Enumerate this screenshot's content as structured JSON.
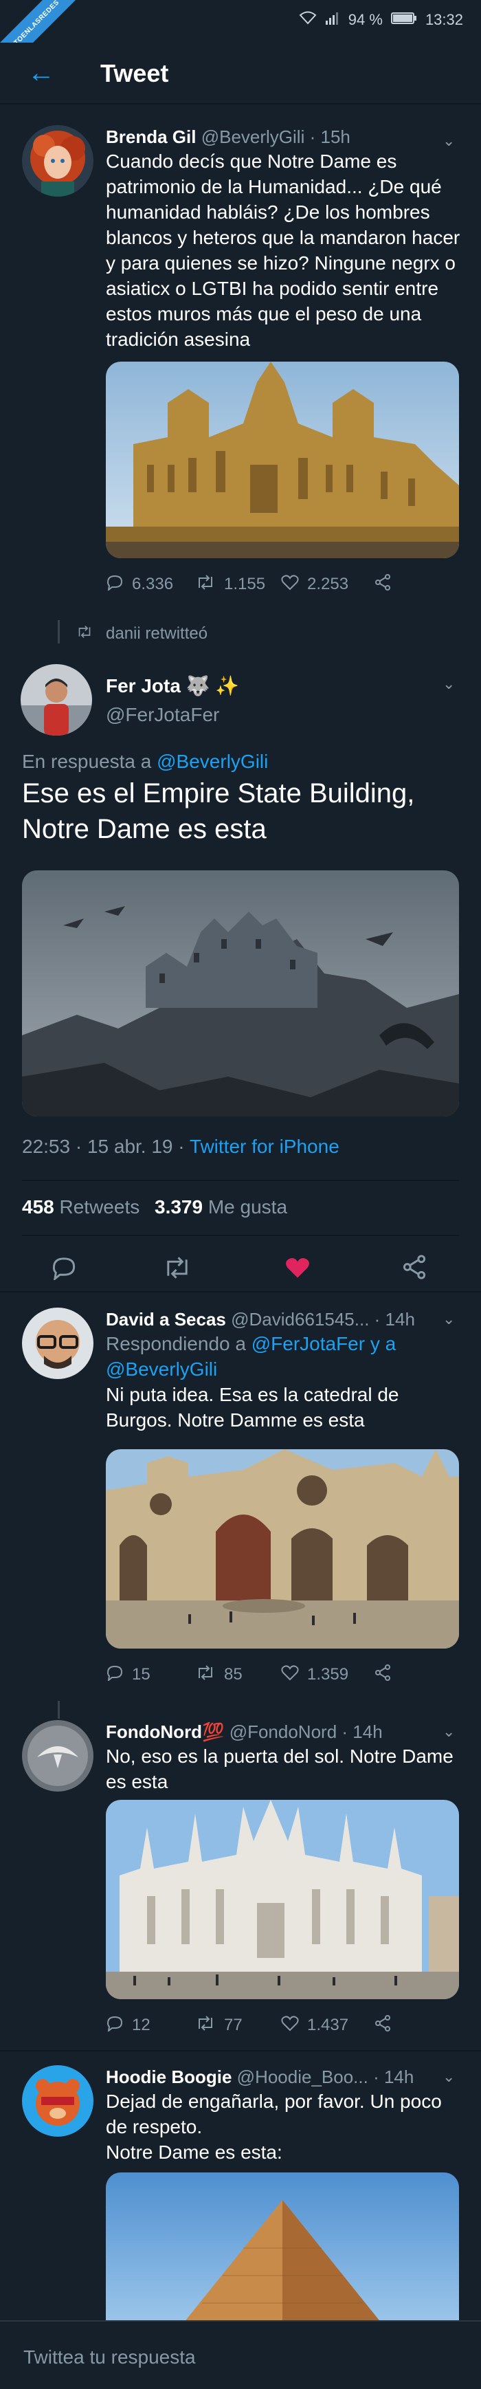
{
  "statusbar": {
    "battery": "94 %",
    "time": "13:32",
    "ribbon": "VISTOENLASREDES"
  },
  "header": {
    "title": "Tweet",
    "back": "←"
  },
  "tweets": [
    {
      "name": "Brenda Gil",
      "handle": "@BeverlyGili",
      "time": "· 15h",
      "text": "Cuando decís que Notre Dame es patrimonio de la Humanidad... ¿De qué humanidad habláis? ¿De los hombres blancos y heteros que la mandaron hacer y para quienes se hizo? Ningune negrx o asiaticx o LGTBI ha podido sentir entre estos muros más que el peso de una tradición asesina",
      "replies": "6.336",
      "retweets": "1.155",
      "likes": "2.253"
    },
    {
      "retweeted_by": "danii retwitteó",
      "name": "Fer Jota",
      "emoji": "🐺 ✨",
      "handle": "@FerJotaFer",
      "reply_prefix": "En respuesta a",
      "reply_to": "@BeverlyGili",
      "text": "Ese es el Empire State Building, Notre Dame es esta",
      "timestamp": "22:53 · 15 abr. 19 ·",
      "client": "Twitter for iPhone",
      "retweets_count": "458",
      "retweets_label": "Retweets",
      "likes_count": "3.379",
      "likes_label": "Me gusta"
    },
    {
      "name": "David a Secas",
      "handle": "@David661545...",
      "time": "· 14h",
      "reply_prefix": "Respondiendo a",
      "reply_to": "@FerJotaFer y a @BeverlyGili",
      "text": "Ni puta idea. Esa es la catedral de Burgos. Notre Damme es esta",
      "replies": "15",
      "retweets": "85",
      "likes": "1.359"
    },
    {
      "name": "FondoNord",
      "emoji": "💯",
      "handle": "@FondoNord",
      "time": "· 14h",
      "text": "No, eso es la puerta del sol. Notre Dame es esta",
      "replies": "12",
      "retweets": "77",
      "likes": "1.437"
    },
    {
      "name": "Hoodie Boogie",
      "handle": "@Hoodie_Boo...",
      "time": "· 14h",
      "text_lines": [
        "Dejad de engañarla, por favor. Un poco de respeto.",
        "Notre Dame es esta:"
      ]
    }
  ],
  "reply_bar": {
    "placeholder": "Twittea tu respuesta"
  },
  "colors": {
    "background": "#15202b",
    "accent": "#1da1f2",
    "secondary_text": "#8899a6",
    "like_active": "#e0245e"
  }
}
